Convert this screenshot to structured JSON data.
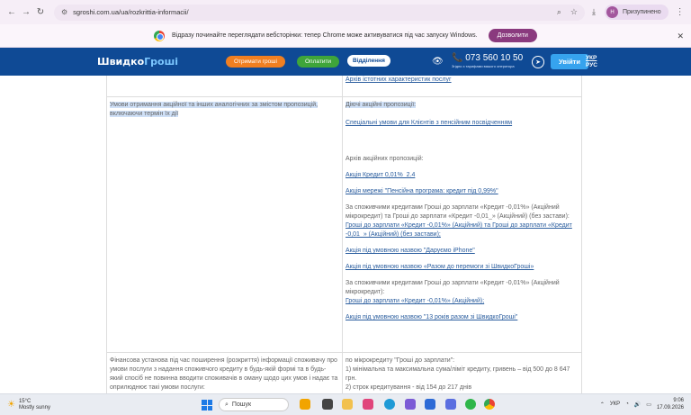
{
  "browser": {
    "url": "sgroshi.com.ua/ua/rozkrittia-informacii/",
    "profile_initial": "Н",
    "profile_name": "Призупинено"
  },
  "infobar": {
    "message": "Відразу починайте переглядати вебсторінки: тепер Chrome може активуватися під час запуску Windows.",
    "allow_label": "Дозволити"
  },
  "header": {
    "logo_part1": "Швидко",
    "logo_part2": "Гроші",
    "get_money_label": "Отримати гроші",
    "pay_label": "Оплатити",
    "branches_label": "Відділення",
    "phone": "073 560 10 50",
    "phone_sub": "Згідно з тарифами вашого оператора",
    "login_label": "Увійти",
    "lang_ukr": "УКР",
    "lang_rus": "РУС"
  },
  "content": {
    "top_link": "Архів істотних характеристик послуг",
    "row1_left": "Умови отримання акційної та інших аналогічних за змістом пропозицій, включаючи термін їх дії",
    "current_offers_label": "Діючі акційні пропозиції:",
    "link_pensioners": "Спеціальні умови для Клієнтів з пенсійним посвідченням",
    "archive_label": "Архів акційних пропозицій:",
    "link_credit": "Акція Кредит 0,01%_2.4",
    "link_pension": "Акція мережі \"Пенсійна програма: кредит під 0,99%\"",
    "para1_text": "За споживчими кредитами Гроші до зарплати «Кредит -0,01%» (Акційний мікрокредит) та Гроші до зарплати «Кредит -0,01_» (Акційний) (без застави):",
    "para1_link": "Гроші до зарплати «Кредит -0,01%» (Акційний) та Гроші до зарплати «Кредит -0,01_» (Акційний) (без застави);",
    "link_iphone": "Акція під умовною назвою \"Даруємо iPhone\"",
    "link_victory": "Акція під умовною назвою «Разом до перемоги зі ШвидкоГроші»",
    "para2_text": "За споживчими кредитами Гроші до зарплати «Кредит -0,01%» (Акційний мікрокредит):",
    "para2_link": "Гроші до зарплати «Кредит -0,01%» (Акційний);",
    "link_13years": "Акція під умовною назвою \"13 років разом зі ШвидкоГроші\"",
    "row2_left": "Фінансова установа під час поширення (розкриття) інформації споживачу про умови послуги з надання споживчого кредиту в будь-якій формі та в будь-який спосіб не повинна вводити споживачів в оману щодо цих умов і надає та оприлюднює такі умови послуги:",
    "row2_right_1": "по мікрокредиту \"Гроші до зарплати\":",
    "row2_right_2": "1) мінімальна та максимальна сума/ліміт кредиту, гривень – від 500 до 8 647 грн.",
    "row2_right_3": "2) строк кредитування - від 154 до 217 днів"
  },
  "taskbar": {
    "temp": "15°C",
    "weather": "Mostly sunny",
    "search": "Пошук",
    "lang": "УКР",
    "time": "9:06",
    "date": "17.09.2026"
  },
  "colors": {
    "header_bg": "#0f4a95",
    "get_money_bg": "#f07f21",
    "pay_bg": "#3fa53a",
    "login_bg": "#36a3ee",
    "allow_bg": "#8a3a7e",
    "link": "#2a5d9e",
    "selection": "#cfe0f7"
  }
}
